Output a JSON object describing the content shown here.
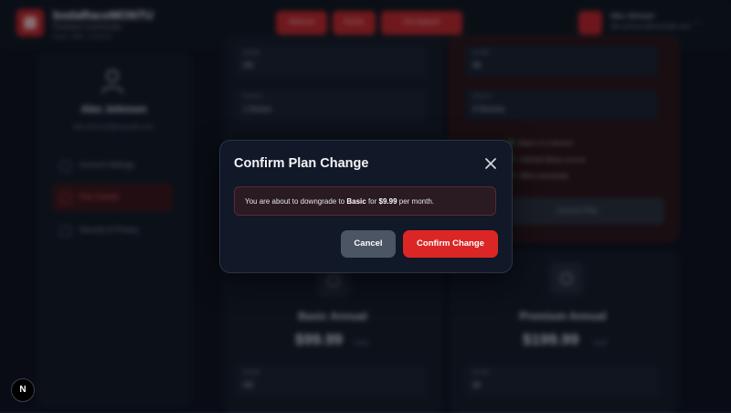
{
  "header": {
    "brand": "bodaRaceMONTU",
    "brand_sub": "Premium Community",
    "brand_sub2": "Race. Ride. Connect.",
    "nav": [
      "Welcome",
      "Events",
      "Get Support!"
    ],
    "user_name": "Alex Johnson",
    "user_email": "alex.johnson@example.com"
  },
  "sidebar": {
    "name": "Alex Johnson",
    "email": "alex.johnson@example.com",
    "items": [
      {
        "label": "Account Settings",
        "icon": "gear-icon"
      },
      {
        "label": "Plan Details",
        "icon": "card-icon"
      },
      {
        "label": "Security & Privacy",
        "icon": "shield-icon"
      }
    ]
  },
  "plans": {
    "basic": {
      "fields": [
        {
          "label": "Quality",
          "value": "HD"
        },
        {
          "label": "Devices",
          "value": "1 Device"
        }
      ]
    },
    "current": {
      "fields": [
        {
          "label": "Quality",
          "value": "4K"
        },
        {
          "label": "Devices",
          "value": "4 Devices"
        }
      ],
      "features": [
        "Watch on 4 devices",
        "Unlimited library access",
        "Offline downloads"
      ],
      "button": "Current Plan"
    },
    "basic_annual": {
      "title": "Basic Annual",
      "price": "$99.99",
      "period": "/year",
      "field_label": "Quality",
      "field_value": "HD"
    },
    "premium_annual": {
      "title": "Premium Annual",
      "price": "$199.99",
      "period": "/year",
      "field_label": "Quality",
      "field_value": "4K"
    }
  },
  "modal": {
    "title": "Confirm Plan Change",
    "notice_prefix": "You are about to downgrade to ",
    "plan": "Basic",
    "mid": " for ",
    "price": "$9.99",
    "suffix": " per month.",
    "cancel": "Cancel",
    "confirm": "Confirm Change"
  },
  "badge": "N",
  "colors": {
    "accent": "#dc2626",
    "cancel": "#4b5563",
    "modal_bg": "#111827",
    "notice_bg": "#2a1a22"
  }
}
